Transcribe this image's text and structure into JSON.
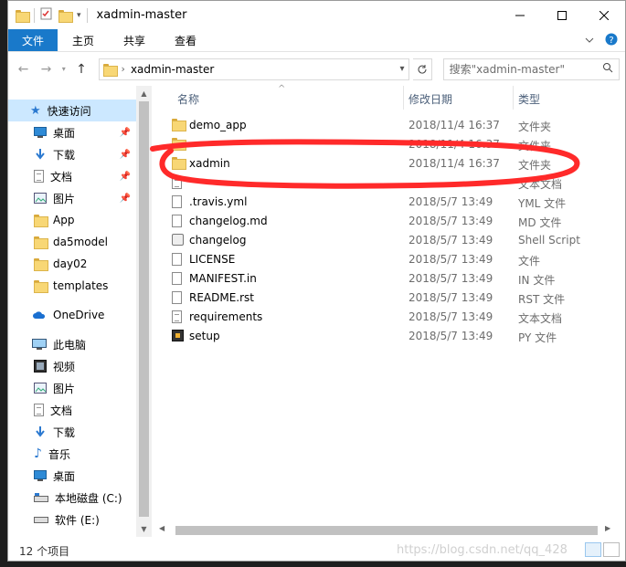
{
  "window": {
    "title": "xadmin-master"
  },
  "ribbon": {
    "tabs": [
      "文件",
      "主页",
      "共享",
      "查看"
    ]
  },
  "address": {
    "path": "xadmin-master",
    "search_placeholder": "搜索\"xadmin-master\""
  },
  "nav": {
    "quick_access": "快速访问",
    "quick_items": [
      "桌面",
      "下载",
      "文档",
      "图片"
    ],
    "folders": [
      "App",
      "da5model",
      "day02",
      "templates"
    ],
    "onedrive": "OneDrive",
    "this_pc": "此电脑",
    "pc_items": [
      "视频",
      "图片",
      "文档",
      "下载",
      "音乐",
      "桌面",
      "本地磁盘 (C:)",
      "软件 (E:)"
    ]
  },
  "columns": {
    "name": "名称",
    "date": "修改日期",
    "type": "类型"
  },
  "files": [
    {
      "name": "demo_app",
      "date": "2018/11/4 16:37",
      "type": "文件夹",
      "icon": "folder-icon"
    },
    {
      "name": "",
      "date": "2018/11/4 16:37",
      "type": "文件夹",
      "icon": "folder-icon"
    },
    {
      "name": "xadmin",
      "date": "2018/11/4 16:37",
      "type": "文件夹",
      "icon": "folder-icon"
    },
    {
      "name": "",
      "date": "",
      "type": "文本文档",
      "icon": "text-doc-icon"
    },
    {
      "name": ".travis.yml",
      "date": "2018/5/7 13:49",
      "type": "YML 文件",
      "icon": "file-icon"
    },
    {
      "name": "changelog.md",
      "date": "2018/5/7 13:49",
      "type": "MD 文件",
      "icon": "file-icon"
    },
    {
      "name": "changelog",
      "date": "2018/5/7 13:49",
      "type": "Shell Script",
      "icon": "shell-script-icon"
    },
    {
      "name": "LICENSE",
      "date": "2018/5/7 13:49",
      "type": "文件",
      "icon": "file-icon"
    },
    {
      "name": "MANIFEST.in",
      "date": "2018/5/7 13:49",
      "type": "IN 文件",
      "icon": "file-icon"
    },
    {
      "name": "README.rst",
      "date": "2018/5/7 13:49",
      "type": "RST 文件",
      "icon": "file-icon"
    },
    {
      "name": "requirements",
      "date": "2018/5/7 13:49",
      "type": "文本文档",
      "icon": "text-doc-icon"
    },
    {
      "name": "setup",
      "date": "2018/5/7 13:49",
      "type": "PY 文件",
      "icon": "python-file-icon"
    }
  ],
  "status": {
    "count": "12 个项目"
  },
  "watermark": "https://blog.csdn.net/qq_428",
  "colors": {
    "file_tab": "#1979ca",
    "quick_access_bg": "#cce8ff",
    "annotation_red": "#ff2a2a"
  }
}
